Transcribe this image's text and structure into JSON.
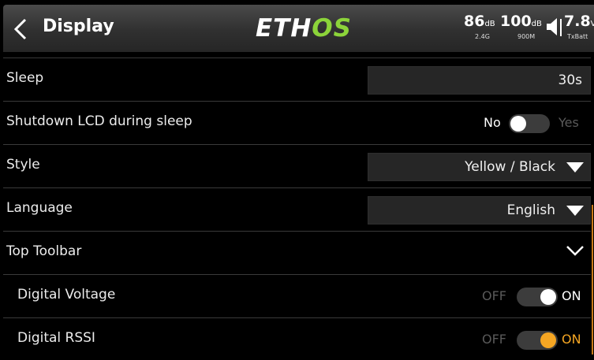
{
  "header": {
    "title": "Display",
    "logo_left": "ETH",
    "logo_right": "OS",
    "rssi1": {
      "value": "86",
      "unit": "dB",
      "band": "2.4G"
    },
    "rssi2": {
      "value": "100",
      "unit": "dB",
      "band": "900M"
    },
    "voltage": {
      "value": "7.8",
      "unit": "V",
      "label": "TxBatt"
    },
    "logo_color_right": "#8cd43a"
  },
  "rows": {
    "sleep": {
      "label": "Sleep",
      "value": "30s"
    },
    "shutdown_lcd": {
      "label": "Shutdown LCD during sleep",
      "off_text": "No",
      "on_text": "Yes",
      "state": "off"
    },
    "style": {
      "label": "Style",
      "value": "Yellow / Black"
    },
    "language": {
      "label": "Language",
      "value": "English"
    },
    "top_toolbar": {
      "label": "Top Toolbar",
      "expanded": true
    },
    "digital_voltage": {
      "label": "Digital Voltage",
      "off_text": "OFF",
      "on_text": "ON",
      "state": "on",
      "accent": "#ffffff"
    },
    "digital_rssi": {
      "label": "Digital RSSI",
      "off_text": "OFF",
      "on_text": "ON",
      "state": "on",
      "accent": "#f5a623"
    }
  },
  "colors": {
    "accent_orange": "#f5a623",
    "background": "#000000"
  }
}
